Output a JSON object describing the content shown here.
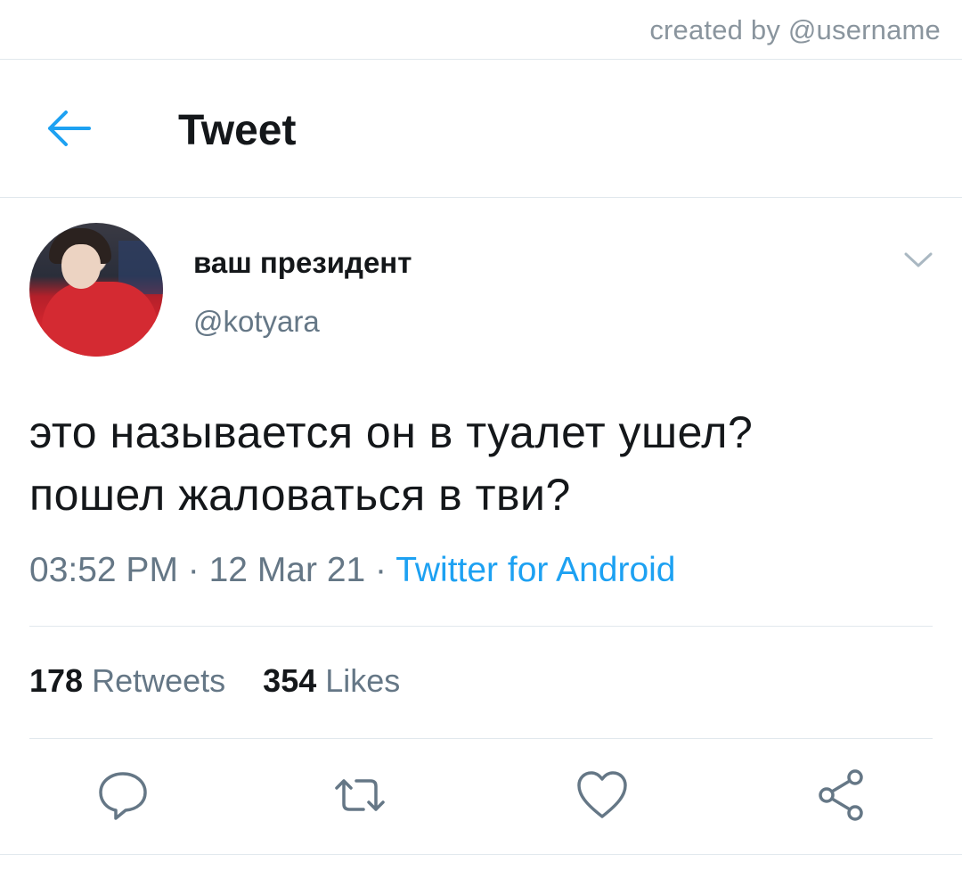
{
  "credit": {
    "text": "created by @username"
  },
  "header": {
    "title": "Tweet"
  },
  "author": {
    "name": "ваш президент",
    "handle": "@kotyara"
  },
  "tweet": {
    "lines": [
      "это называется он в туалет ушел?",
      "пошел жаловаться в тви?"
    ],
    "time": "03:52 PM",
    "separator": " · ",
    "date": "12 Mar 21",
    "source": "Twitter for Android"
  },
  "stats": {
    "retweets_count": "178",
    "retweets_label": "Retweets",
    "likes_count": "354",
    "likes_label": "Likes"
  },
  "colors": {
    "accent": "#1da1f2",
    "text_primary": "#14171a",
    "text_secondary": "#657786",
    "divider": "#e1e8ed"
  },
  "icons": {
    "back": "arrow-left-icon",
    "more": "chevron-down-icon",
    "reply": "reply-icon",
    "retweet": "retweet-icon",
    "like": "heart-icon",
    "share": "share-icon"
  }
}
